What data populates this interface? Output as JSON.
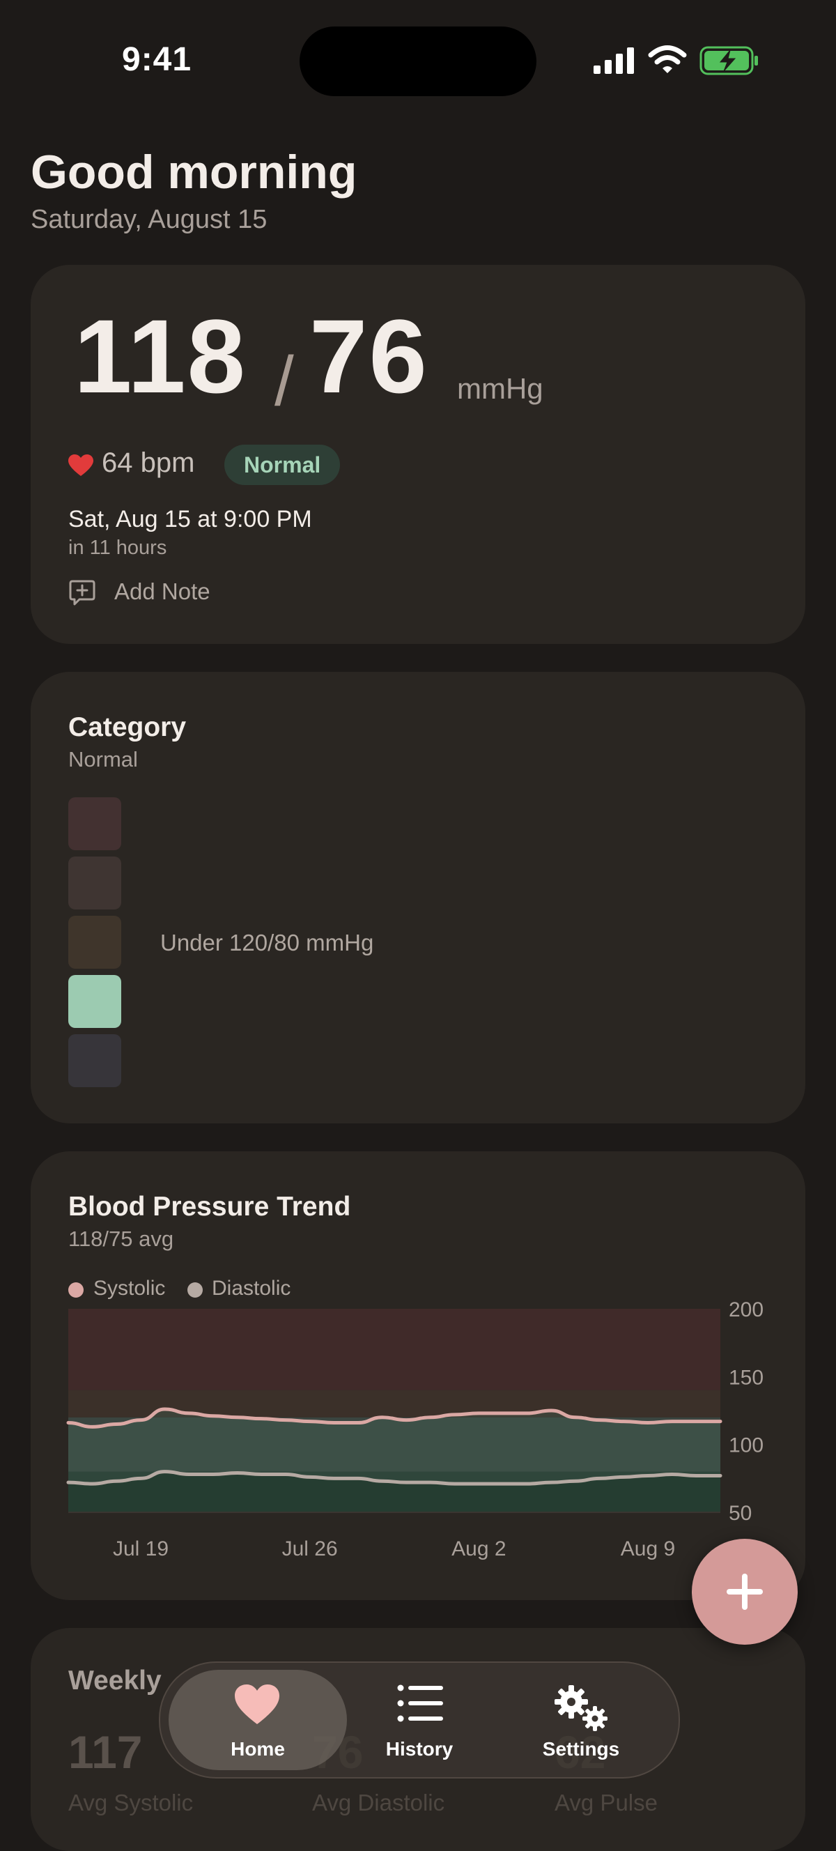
{
  "status": {
    "time": "9:41"
  },
  "greeting": "Good morning",
  "date": "Saturday, August 15",
  "reading": {
    "systolic": "118",
    "separator": "/",
    "diastolic": "76",
    "unit": "mmHg",
    "pulse": "64 bpm",
    "status_badge": "Normal",
    "schedule": "Sat, Aug 15 at 9:00 PM",
    "schedule_relative": "in 11 hours",
    "add_note_label": "Add Note"
  },
  "category": {
    "title": "Category",
    "current": "Normal",
    "description": "Under 120/80 mmHg",
    "levels": [
      {
        "color": "#433131"
      },
      {
        "color": "#3f3532"
      },
      {
        "color": "#3f352b"
      },
      {
        "color": "#9ccbb1",
        "active": true
      },
      {
        "color": "#37353a"
      }
    ]
  },
  "trend": {
    "title": "Blood Pressure Trend",
    "subtitle": "118/75 avg",
    "legend": [
      {
        "label": "Systolic",
        "color": "#dba8a4"
      },
      {
        "label": "Diastolic",
        "color": "#b6aaa3"
      }
    ]
  },
  "chart_data": {
    "type": "line",
    "x": [
      "Jul 16",
      "Jul 17",
      "Jul 18",
      "Jul 19",
      "Jul 20",
      "Jul 21",
      "Jul 22",
      "Jul 23",
      "Jul 24",
      "Jul 25",
      "Jul 26",
      "Jul 27",
      "Jul 28",
      "Jul 29",
      "Jul 30",
      "Jul 31",
      "Aug 1",
      "Aug 2",
      "Aug 3",
      "Aug 4",
      "Aug 5",
      "Aug 6",
      "Aug 7",
      "Aug 8",
      "Aug 9",
      "Aug 10",
      "Aug 11",
      "Aug 12"
    ],
    "x_ticks": [
      "Jul 19",
      "Jul 26",
      "Aug 2",
      "Aug 9"
    ],
    "y_ticks": [
      200,
      150,
      100,
      50
    ],
    "ylim": [
      50,
      200
    ],
    "series": [
      {
        "name": "Systolic",
        "values": [
          116,
          113,
          115,
          118,
          126,
          123,
          121,
          120,
          119,
          118,
          117,
          116,
          116,
          120,
          118,
          120,
          122,
          123,
          123,
          123,
          125,
          120,
          118,
          117,
          116,
          117,
          117,
          117
        ]
      },
      {
        "name": "Diastolic",
        "values": [
          72,
          71,
          73,
          75,
          80,
          78,
          78,
          79,
          78,
          78,
          76,
          75,
          75,
          73,
          72,
          72,
          71,
          71,
          71,
          71,
          72,
          73,
          75,
          76,
          77,
          78,
          77,
          77
        ]
      }
    ],
    "zones": [
      {
        "from": 50,
        "to": 80,
        "color": "#24362d"
      },
      {
        "from": 80,
        "to": 120,
        "color": "#3a4540"
      },
      {
        "from": 120,
        "to": 140,
        "color": "#3b3029"
      },
      {
        "from": 140,
        "to": 200,
        "color": "#402a29"
      }
    ]
  },
  "weekly": {
    "title": "Weekly",
    "stats": [
      {
        "value": "117",
        "label": "Avg Systolic"
      },
      {
        "value": "76",
        "label": "Avg Diastolic"
      },
      {
        "value": "62",
        "label": "Avg Pulse"
      }
    ]
  },
  "tabs": [
    {
      "label": "Home",
      "icon": "heart-icon",
      "active": true
    },
    {
      "label": "History",
      "icon": "list-icon"
    },
    {
      "label": "Settings",
      "icon": "gear-icon"
    }
  ]
}
